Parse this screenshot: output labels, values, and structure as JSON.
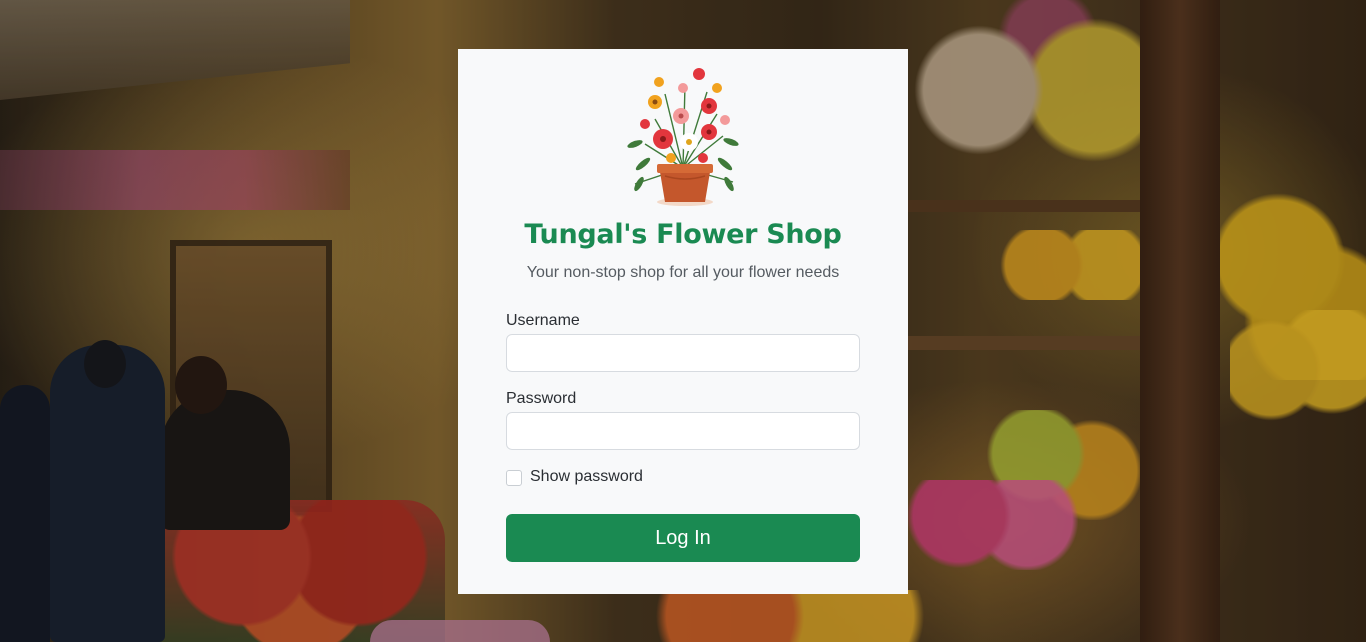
{
  "shop": {
    "title": "Tungal's Flower Shop",
    "tagline": "Your non-stop shop for all your flower needs"
  },
  "form": {
    "username_label": "Username",
    "username_value": "",
    "password_label": "Password",
    "password_value": "",
    "show_password_label": "Show password",
    "show_password_checked": false,
    "login_label": "Log In"
  },
  "colors": {
    "brand_green": "#1a8a52",
    "card_bg": "#f8f9fa",
    "subtitle": "#555b61"
  },
  "icons": {
    "logo": "flower-pot-icon"
  }
}
